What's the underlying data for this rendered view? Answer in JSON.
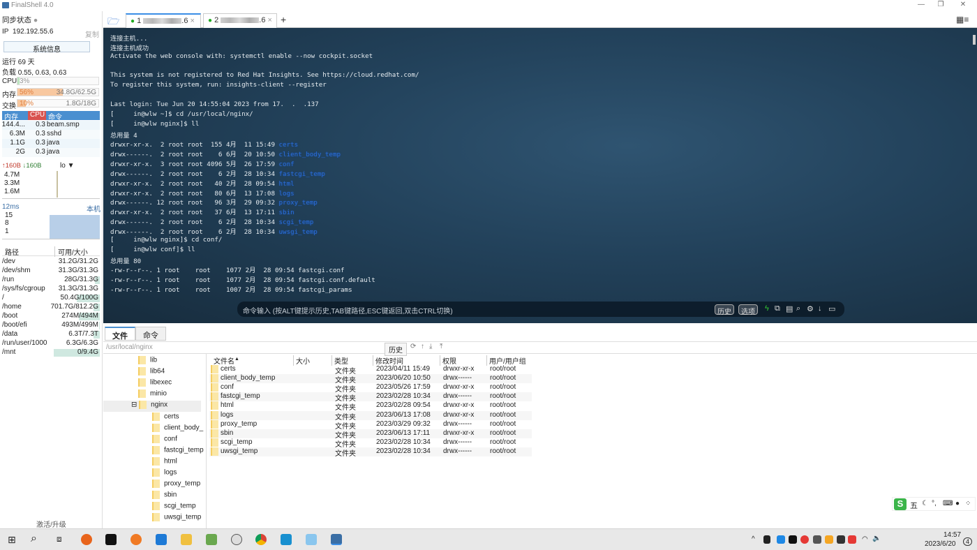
{
  "app": {
    "title": "FinalShell 4.0"
  },
  "sidebar": {
    "sync_label": "同步状态",
    "ip_label": "IP",
    "ip": "192.192.55.6",
    "copy": "复制",
    "sysinfo_button": "系统信息",
    "uptime": "运行 69 天",
    "load": "负载 0.55, 0.63, 0.63",
    "cpu": {
      "label": "CPU",
      "pct": "3%",
      "value": 3
    },
    "mem": {
      "label": "内存",
      "pct": "56%",
      "value": 56,
      "detail": "34.8G/62.5G"
    },
    "swap": {
      "label": "交换",
      "pct": "10%",
      "value": 10,
      "detail": "1.8G/18G"
    },
    "proc_headers": [
      "内存",
      "CPU",
      "命令"
    ],
    "procs": [
      {
        "mem": "144.4...",
        "cpu": "0.3",
        "cmd": "beam.smp"
      },
      {
        "mem": "6.3M",
        "cpu": "0.3",
        "cmd": "sshd"
      },
      {
        "mem": "1.1G",
        "cpu": "0.3",
        "cmd": "java"
      },
      {
        "mem": "2G",
        "cpu": "0.3",
        "cmd": "java"
      }
    ],
    "net": {
      "up": "↑160B",
      "down": "↓160B",
      "iface": "lo",
      "ticks": [
        "4.7M",
        "3.3M",
        "1.6M"
      ]
    },
    "ping": {
      "latency": "12ms",
      "host": "本机",
      "ticks": [
        "15",
        "8",
        "1"
      ]
    },
    "disk_headers": [
      "路径",
      "可用/大小"
    ],
    "disks": [
      {
        "path": "/dev",
        "v": "31.2G/31.2G",
        "u": 0
      },
      {
        "path": "/dev/shm",
        "v": "31.3G/31.3G",
        "u": 0
      },
      {
        "path": "/run",
        "v": "28G/31.3G",
        "u": 10
      },
      {
        "path": "/sys/fs/cgroup",
        "v": "31.3G/31.3G",
        "u": 0
      },
      {
        "path": "/",
        "v": "50.4G/100G",
        "u": 50
      },
      {
        "path": "/home",
        "v": "701.7G/812.2G",
        "u": 14
      },
      {
        "path": "/boot",
        "v": "274M/494M",
        "u": 45
      },
      {
        "path": "/boot/efi",
        "v": "493M/499M",
        "u": 1
      },
      {
        "path": "/data",
        "v": "6.3T/7.3T",
        "u": 14
      },
      {
        "path": "/run/user/1000",
        "v": "6.3G/6.3G",
        "u": 0
      },
      {
        "path": "/mnt",
        "v": "0/9.4G",
        "u": 100
      }
    ],
    "activate": "激活/升级"
  },
  "tabs": [
    {
      "label": "1",
      "suffix": ".6"
    },
    {
      "label": "2",
      "suffix": ".6"
    }
  ],
  "terminal": {
    "lines": [
      {
        "t": "连接主机..."
      },
      {
        "t": "连接主机成功"
      },
      {
        "t": "Activate the web console with: systemctl enable --now cockpit.socket"
      },
      {
        "t": ""
      },
      {
        "t": "This system is not registered to Red Hat Insights. See https://cloud.redhat.com/"
      },
      {
        "t": "To register this system, run: insights-client --register"
      },
      {
        "t": ""
      },
      {
        "t": "Last login: Tue Jun 20 14:55:04 2023 from 17.  .  .137"
      },
      {
        "t": "[     in@wlw ~]$ cd /usr/local/nginx/"
      },
      {
        "t": "[     in@wlw nginx]$ ll"
      },
      {
        "t": "总用量 4"
      },
      {
        "t": "drwxr-xr-x.  2 root root  155 4月  11 15:49 ",
        "d": "certs"
      },
      {
        "t": "drwx------.  2 root root    6 6月  20 10:50 ",
        "d": "client_body_temp"
      },
      {
        "t": "drwxr-xr-x.  3 root root 4096 5月  26 17:59 ",
        "d": "conf"
      },
      {
        "t": "drwx------.  2 root root    6 2月  28 10:34 ",
        "d": "fastcgi_temp"
      },
      {
        "t": "drwxr-xr-x.  2 root root   40 2月  28 09:54 ",
        "d": "html"
      },
      {
        "t": "drwxr-xr-x.  2 root root   80 6月  13 17:08 ",
        "d": "logs"
      },
      {
        "t": "drwx------. 12 root root   96 3月  29 09:32 ",
        "d": "proxy_temp"
      },
      {
        "t": "drwxr-xr-x.  2 root root   37 6月  13 17:11 ",
        "d": "sbin"
      },
      {
        "t": "drwx------.  2 root root    6 2月  28 10:34 ",
        "d": "scgi_temp"
      },
      {
        "t": "drwx------.  2 root root    6 2月  28 10:34 ",
        "d": "uwsgi_temp"
      },
      {
        "t": "[     in@wlw nginx]$ cd conf/"
      },
      {
        "t": "[     in@wlw conf]$ ll"
      },
      {
        "t": "总用量 80"
      },
      {
        "t": "-rw-r--r--. 1 root    root    1077 2月  28 09:54 fastcgi.conf"
      },
      {
        "t": "-rw-r--r--. 1 root    root    1077 2月  28 09:54 fastcgi.conf.default"
      },
      {
        "t": "-rw-r--r--. 1 root    root    1007 2月  28 09:54 fastcgi_params"
      }
    ],
    "cmd_placeholder": "命令输入 (按ALT键提示历史,TAB键路径,ESC键返回,双击CTRL切换)",
    "history": "历史",
    "options": "选项"
  },
  "files": {
    "tabs": [
      "文件",
      "命令"
    ],
    "path": "/usr/local/nginx",
    "history": "历史",
    "tree": [
      {
        "n": "lib",
        "l": 0
      },
      {
        "n": "lib64",
        "l": 0
      },
      {
        "n": "libexec",
        "l": 0
      },
      {
        "n": "minio",
        "l": 0
      },
      {
        "n": "nginx",
        "l": 0,
        "open": true
      },
      {
        "n": "certs",
        "l": 1
      },
      {
        "n": "client_body_",
        "l": 1
      },
      {
        "n": "conf",
        "l": 1
      },
      {
        "n": "fastcgi_temp",
        "l": 1
      },
      {
        "n": "html",
        "l": 1
      },
      {
        "n": "logs",
        "l": 1
      },
      {
        "n": "proxy_temp",
        "l": 1
      },
      {
        "n": "sbin",
        "l": 1
      },
      {
        "n": "scgi_temp",
        "l": 1
      },
      {
        "n": "uwsgi_temp",
        "l": 1
      }
    ],
    "headers": [
      "文件名",
      "大小",
      "类型",
      "修改时间",
      "权限",
      "用户/用户组"
    ],
    "rows": [
      [
        "certs",
        "",
        "文件夹",
        "2023/04/11 15:49",
        "drwxr-xr-x",
        "root/root"
      ],
      [
        "client_body_temp",
        "",
        "文件夹",
        "2023/06/20 10:50",
        "drwx------",
        "root/root"
      ],
      [
        "conf",
        "",
        "文件夹",
        "2023/05/26 17:59",
        "drwxr-xr-x",
        "root/root"
      ],
      [
        "fastcgi_temp",
        "",
        "文件夹",
        "2023/02/28 10:34",
        "drwx------",
        "root/root"
      ],
      [
        "html",
        "",
        "文件夹",
        "2023/02/28 09:54",
        "drwxr-xr-x",
        "root/root"
      ],
      [
        "logs",
        "",
        "文件夹",
        "2023/06/13 17:08",
        "drwxr-xr-x",
        "root/root"
      ],
      [
        "proxy_temp",
        "",
        "文件夹",
        "2023/03/29 09:32",
        "drwx------",
        "root/root"
      ],
      [
        "sbin",
        "",
        "文件夹",
        "2023/06/13 17:11",
        "drwxr-xr-x",
        "root/root"
      ],
      [
        "scgi_temp",
        "",
        "文件夹",
        "2023/02/28 10:34",
        "drwx------",
        "root/root"
      ],
      [
        "uwsgi_temp",
        "",
        "文件夹",
        "2023/02/28 10:34",
        "drwx------",
        "root/root"
      ]
    ]
  },
  "ime": {
    "mode": "五"
  },
  "taskbar": {
    "time": "14:57",
    "date": "2023/6/20",
    "notif": "4"
  }
}
